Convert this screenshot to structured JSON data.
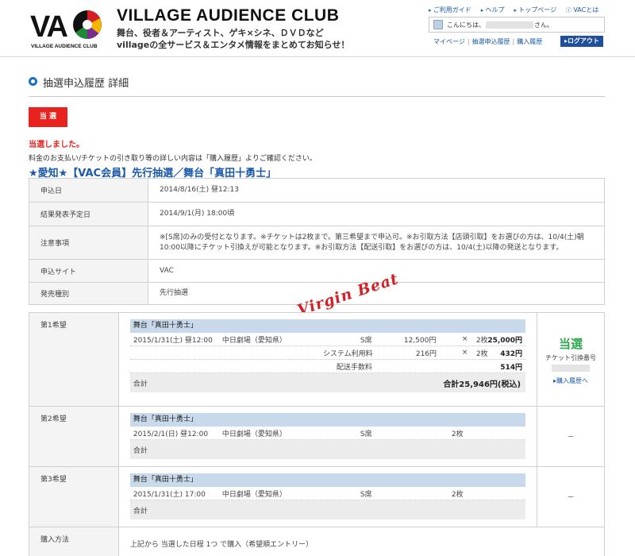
{
  "header": {
    "brand_title": "VILLAGE AUDIENCE CLUB",
    "logo_text": "VAC",
    "logo_subtext": "VILLAGE AUDIENCE CLUB",
    "tagline_line1": "舞台、役者＆アーティスト、ゲキ×シネ、ＤＶＤなど",
    "tagline_line2": "villageの全サービス＆エンタメ情報をまとめてお知らせ！",
    "top_links": [
      "ご利用ガイド",
      "ヘルプ",
      "トップページ",
      "VACとは"
    ],
    "greeting_prefix": "こんにちは、",
    "greeting_suffix": "さん。",
    "sub_links": [
      "マイページ",
      "抽選申込履歴",
      "購入履歴"
    ],
    "logout_label": "▸ログアウト"
  },
  "page": {
    "title": "抽選申込履歴 詳細",
    "badge": "当 選",
    "win_message": "当選しました。",
    "win_note": "料金のお支払い/チケットの引き取り等の詳しい内容は「購入履歴」よりご確認ください。",
    "event_title": "★愛知★【VAC会員】先行抽選／舞台「真田十勇士」"
  },
  "info": [
    {
      "label": "申込日",
      "value": "2014/8/16(土) 昼12:13"
    },
    {
      "label": "結果発表予定日",
      "value": "2014/9/1(月) 18:00頃"
    },
    {
      "label": "注意事項",
      "value": "※[S席]のみの受付となります。※チケットは2枚まで。第三希望まで申込可。※お引取方法【店頭引取】をお選びの方は、10/4(土)朝10:00以降にチケット引換えが可能となります。※お引取方法【配送引取】をお選びの方は、10/4(土)以降の発送となります。"
    },
    {
      "label": "申込サイト",
      "value": "VAC"
    },
    {
      "label": "発売種別",
      "value": "先行抽選"
    }
  ],
  "watermark": "Virgin Beat",
  "wishes": [
    {
      "label": "第1希望",
      "show": "舞台「真田十勇士」",
      "date": "2015/1/31(土) 昼12:00",
      "venue": "中日劇場（愛知県）",
      "seat": "S席",
      "unit_price": "12,500円",
      "times": "×",
      "qty": "2枚",
      "amount": "25,000円",
      "fee_label": "システム利用料",
      "fee_unit": "216円",
      "fee_qty": "2枚",
      "fee_amount": "432円",
      "delivery_label": "配送手数料",
      "delivery_amount": "514円",
      "total_label": "合計",
      "total_value": "合計25,946円(税込)",
      "status": "当選",
      "status_sub": "チケット引換番号",
      "status_link": "▸購入履歴へ"
    },
    {
      "label": "第2希望",
      "show": "舞台「真田十勇士」",
      "date": "2015/2/1(日) 昼12:00",
      "venue": "中日劇場（愛知県）",
      "seat": "S席",
      "qty": "2枚",
      "total_label": "合計",
      "status": "－"
    },
    {
      "label": "第3希望",
      "show": "舞台「真田十勇士」",
      "date": "2015/1/31(土) 17:00",
      "venue": "中日劇場（愛知県）",
      "seat": "S席",
      "qty": "2枚",
      "total_label": "合計",
      "status": "－"
    }
  ],
  "purchase": {
    "label": "購入方法",
    "value": "上記から 当選した日程 1つ で購入（希望順エントリー）"
  },
  "colors": {
    "accent_blue": "#1a5aa8",
    "win_red": "#e8231e",
    "win_green": "#2fa84f",
    "row_head": "#c9d9ec"
  }
}
